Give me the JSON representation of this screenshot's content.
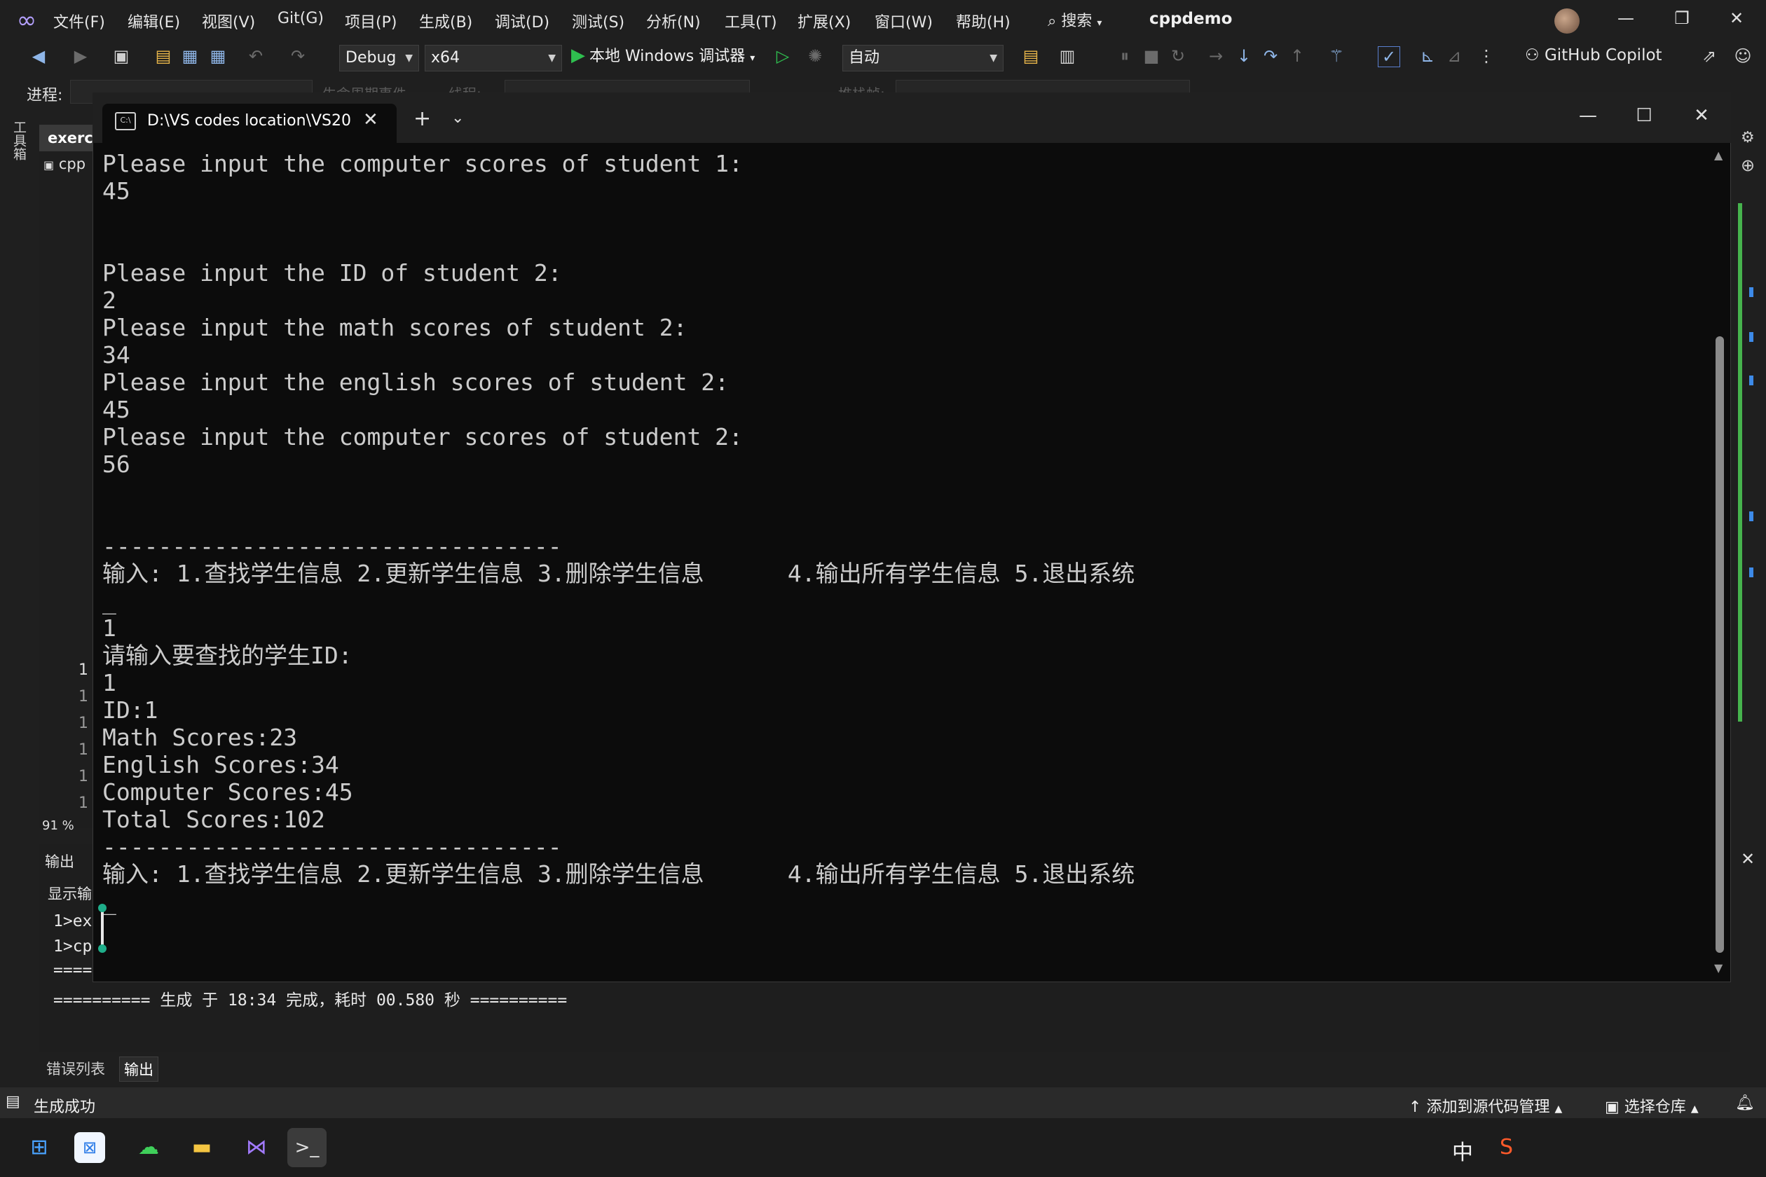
{
  "vs": {
    "menu": [
      "文件(F)",
      "编辑(E)",
      "视图(V)",
      "Git(G)",
      "项目(P)",
      "生成(B)",
      "调试(D)",
      "测试(S)",
      "分析(N)",
      "工具(T)",
      "扩展(X)",
      "窗口(W)",
      "帮助(H)"
    ],
    "search_label": "搜索",
    "project_title": "cppdemo",
    "toolbar": {
      "config": "Debug",
      "platform": "x64",
      "run_label": "本地 Windows 调试器",
      "auto_combo": "自动",
      "copilot": "GitHub Copilot"
    },
    "toolbar2": {
      "process_label": "进程:",
      "lifecycle_events": "生命周期事件",
      "thread_label": "线程:",
      "stack_frame": "堆栈帧:"
    },
    "toolbox_label": "工具箱",
    "editor": {
      "tab": "exerc",
      "file": "cpp",
      "line_numbers": [
        "1",
        "1",
        "1",
        "1",
        "1",
        "1"
      ],
      "zoom": "91 %"
    },
    "output": {
      "header": "输出",
      "show_from": "显示输",
      "lines": [
        "1>ex",
        "1>cp",
        "===="
      ],
      "build_line": "========== 生成 于 18:34 完成，耗时 00.580 秒 =========="
    },
    "bottom_tabs": [
      "错误列表",
      "输出"
    ],
    "status": {
      "left": "生成成功",
      "source_control": "添加到源代码管理",
      "repo": "选择仓库"
    }
  },
  "terminal": {
    "tab_title": "D:\\VS codes location\\VS20",
    "lines": [
      "Please input the computer scores of student 1:",
      "45",
      "",
      "",
      "Please input the ID of student 2:",
      "2",
      "Please input the math scores of student 2:",
      "34",
      "Please input the english scores of student 2:",
      "45",
      "Please input the computer scores of student 2:",
      "56",
      "",
      "",
      "---------------------------------",
      "输入: 1.查找学生信息 2.更新学生信息 3.删除学生信息      4.输出所有学生信息 5.退出系统",
      "_",
      "1",
      "请输入要查找的学生ID:",
      "1",
      "ID:1",
      "Math Scores:23",
      "English Scores:34",
      "Computer Scores:45",
      "Total Scores:102",
      "---------------------------------",
      "输入: 1.查找学生信息 2.更新学生信息 3.删除学生信息      4.输出所有学生信息 5.退出系统",
      "_"
    ]
  },
  "taskbar": {
    "ime": "中",
    "icons": [
      "windows-start-icon",
      "todesk-icon",
      "wechat-icon",
      "file-explorer-icon",
      "visual-studio-icon",
      "terminal-icon",
      "sogou-input-icon"
    ]
  }
}
